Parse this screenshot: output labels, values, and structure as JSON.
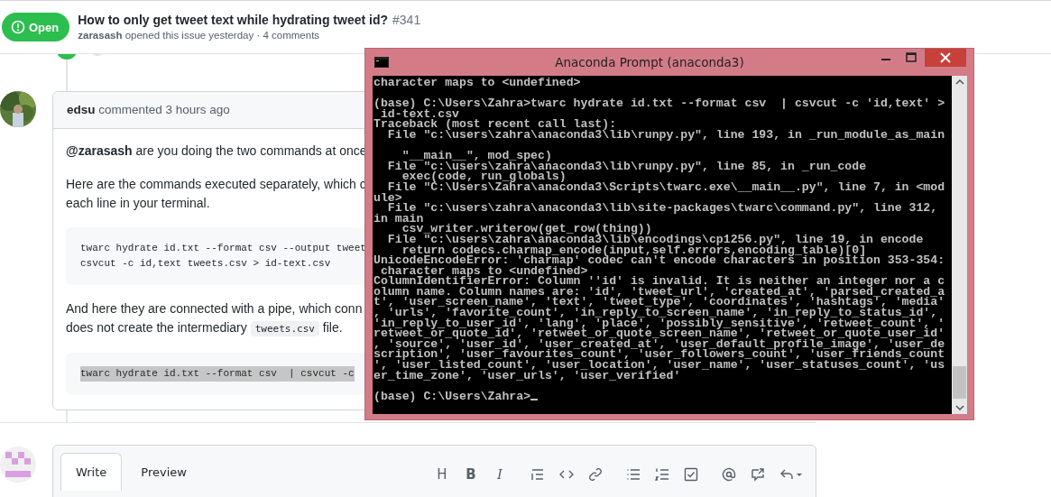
{
  "issue": {
    "state": "Open",
    "title": "How to only get tweet text while hydrating tweet id?",
    "number": "#341",
    "author": "zarasash",
    "meta": " opened this issue yesterday · 4 comments"
  },
  "comment": {
    "author": "edsu",
    "meta": " commented 3 hours ago",
    "body": [
      {
        "kind": "text",
        "lines": [
          "**@zarasash** are you doing the two commands at once"
        ]
      },
      {
        "kind": "text",
        "lines": [
          "Here are the commands executed separately, which c",
          "each line in your terminal."
        ]
      },
      {
        "kind": "code",
        "selected": false,
        "lines": [
          "twarc hydrate id.txt --format csv --output tweet",
          "csvcut -c id,text tweets.csv > id-text.csv"
        ]
      },
      {
        "kind": "text",
        "lines": [
          "And here they are connected with a pipe, which conn"
        ],
        "tail": {
          "before": "does not create the intermediary ",
          "code": "tweets.csv",
          "after": " file."
        }
      },
      {
        "kind": "code",
        "selected": true,
        "lines": [
          "twarc hydrate id.txt --format csv  | csvcut -c"
        ]
      }
    ]
  },
  "composer": {
    "tabs": [
      {
        "label": "Write",
        "selected": true
      },
      {
        "label": "Preview",
        "selected": false
      }
    ],
    "toolbar": [
      [
        {
          "kind": "heading",
          "label": "H"
        },
        {
          "kind": "bold",
          "label": "B"
        },
        {
          "kind": "italic",
          "label": "I"
        }
      ],
      [
        {
          "kind": "quote"
        },
        {
          "kind": "code"
        },
        {
          "kind": "link"
        }
      ],
      [
        {
          "kind": "bullets"
        },
        {
          "kind": "numbers"
        },
        {
          "kind": "tasks"
        }
      ],
      [
        {
          "kind": "mention"
        },
        {
          "kind": "reference"
        },
        {
          "kind": "reply"
        }
      ]
    ]
  },
  "terminal": {
    "title": "Anaconda Prompt (anaconda3)",
    "blocks": [
      [
        "character maps to <undefined>"
      ],
      [
        "(base) C:\\Users\\Zahra>twarc hydrate id.txt --format csv  | csvcut -c 'id,text' >",
        " id-text.csv",
        "Traceback (most recent call last):",
        "  File \"c:\\users\\zahra\\anaconda3\\lib\\runpy.py\", line 193, in _run_module_as_main"
      ],
      [
        "    \"__main__\", mod_spec)",
        "  File \"c:\\users\\zahra\\anaconda3\\lib\\runpy.py\", line 85, in _run_code",
        "    exec(code, run_globals)",
        "  File \"C:\\Users\\Zahra\\anaconda3\\Scripts\\twarc.exe\\__main__.py\", line 7, in <mod",
        "ule>",
        "  File \"c:\\users\\zahra\\anaconda3\\lib\\site-packages\\twarc\\command.py\", line 312,",
        "in main",
        "    csv_writer.writerow(get_row(thing))",
        "  File \"c:\\users\\zahra\\anaconda3\\lib\\encodings\\cp1256.py\", line 19, in encode",
        "    return codecs.charmap_encode(input,self.errors,encoding_table)[0]",
        "UnicodeEncodeError: 'charmap' codec can't encode characters in position 353-354:",
        " character maps to <undefined>",
        "ColumnIdentifierError: Column ''id' is invalid. It is neither an integer nor a c",
        "olumn name. Column names are: 'id', 'tweet_url', 'created_at', 'parsed_created_a",
        "t', 'user_screen_name', 'text', 'tweet_type', 'coordinates', 'hashtags', 'media'",
        ", 'urls', 'favorite_count', 'in_reply_to_screen_name', 'in_reply_to_status_id', ",
        "'in_reply_to_user_id', 'lang', 'place', 'possibly_sensitive', 'retweet_count', '",
        "retweet_or_quote_id', 'retweet_or_quote_screen_name', 'retweet_or_quote_user_id'",
        ", 'source', 'user_id', 'user_created_at', 'user_default_profile_image', 'user_de",
        "scription', 'user_favourites_count', 'user_followers_count', 'user_friends_count",
        "', 'user_listed_count', 'user_location', 'user_name', 'user_statuses_count', 'us",
        "er_time_zone', 'user_urls', 'user_verified'"
      ],
      [
        "(base) C:\\Users\\Zahra>"
      ]
    ]
  }
}
